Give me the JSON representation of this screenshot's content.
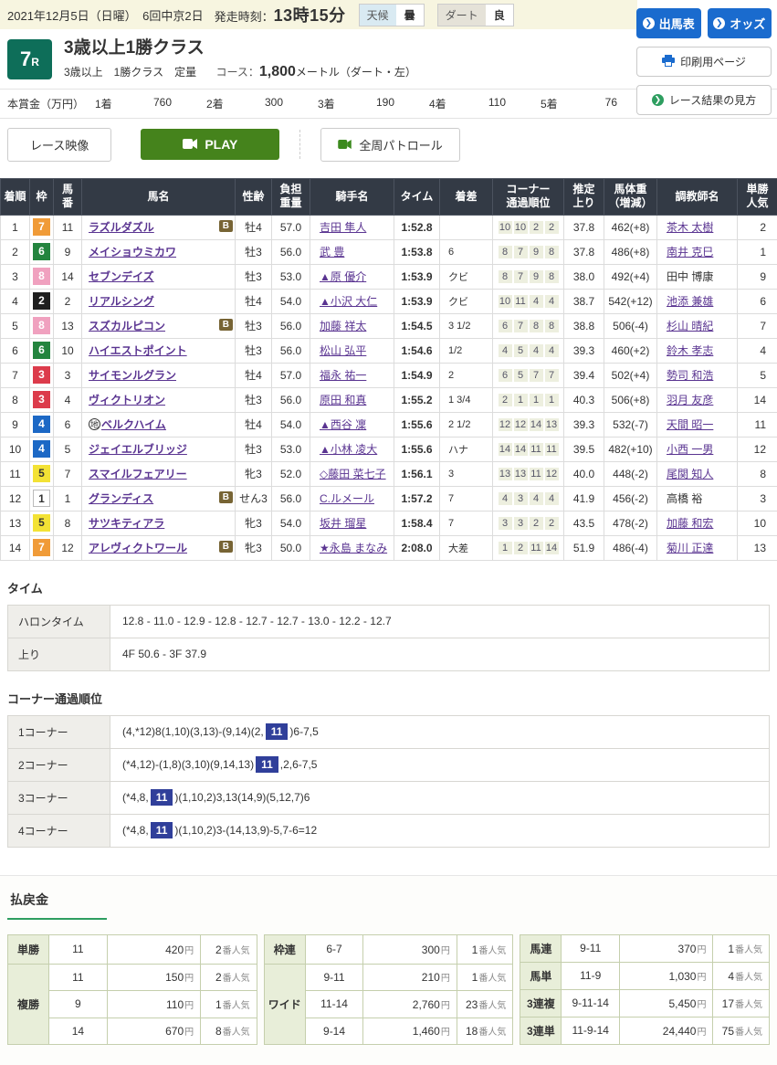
{
  "colors": {
    "accent_blue": "#1a6bce",
    "race_badge_teal": "#0e6e59",
    "link_purple": "#5a3491",
    "table_header": "#333a45",
    "play_green": "#45831c",
    "corner_highlight_navy": "#303f9a",
    "payout_underline_green": "#2e9e60"
  },
  "topbar": {
    "date_text": "2021年12月5日（日曜）　6回中京2日",
    "start_label": "発走時刻：",
    "start_time": "13時15分",
    "weather_label": "天候",
    "weather_value": "曇",
    "track_label": "ダート",
    "track_value": "良",
    "shutsuba_button": "出馬表",
    "odds_button": "オッズ"
  },
  "side_buttons": {
    "print_button": "印刷用ページ",
    "guide_button": "レース結果の見方"
  },
  "race": {
    "number": "7",
    "number_suffix": "R",
    "title": "3歳以上1勝クラス",
    "conditions": "3歳以上　1勝クラス　定量",
    "course_label": "コース：",
    "course_distance": "1,800",
    "course_detail": "メートル（ダート・左）",
    "prize_label": "本賞金（万円）",
    "prizes": [
      {
        "rank": "1着",
        "amount": "760"
      },
      {
        "rank": "2着",
        "amount": "300"
      },
      {
        "rank": "3着",
        "amount": "190"
      },
      {
        "rank": "4着",
        "amount": "110"
      },
      {
        "rank": "5着",
        "amount": "76"
      }
    ]
  },
  "video": {
    "race_video_button": "レース映像",
    "play_button": "PLAY",
    "patrol_button": "全周パトロール"
  },
  "results": {
    "b_label": "B",
    "local_mark": "地",
    "headers": [
      [
        "着順"
      ],
      [
        "枠"
      ],
      [
        "馬",
        "番"
      ],
      [
        "馬名"
      ],
      [
        "性齢"
      ],
      [
        "負担",
        "重量"
      ],
      [
        "騎手名"
      ],
      [
        "タイム"
      ],
      [
        "着差"
      ],
      [
        "コーナー",
        "通過順位"
      ],
      [
        "推定",
        "上り"
      ],
      [
        "馬体重",
        "（増減）"
      ],
      [
        "調教師名"
      ],
      [
        "単勝",
        "人気"
      ]
    ],
    "waku_colors": {
      "1": {
        "bg": "#ffffff",
        "fg": "#333333",
        "border": "#bbbbbb"
      },
      "2": {
        "bg": "#1f1f1f",
        "fg": "#ffffff"
      },
      "3": {
        "bg": "#dc3b4b",
        "fg": "#ffffff"
      },
      "4": {
        "bg": "#1c68c5",
        "fg": "#ffffff"
      },
      "5": {
        "bg": "#f3e235",
        "fg": "#333333"
      },
      "6": {
        "bg": "#23843e",
        "fg": "#ffffff"
      },
      "7": {
        "bg": "#f09b38",
        "fg": "#ffffff"
      },
      "8": {
        "bg": "#f0a1bf",
        "fg": "#ffffff"
      }
    },
    "rows": [
      {
        "pos": "1",
        "waku": "7",
        "num": "11",
        "horse": "ラズルダズル",
        "b": true,
        "local": false,
        "sex": "牡4",
        "weight": "57.0",
        "jockey": "吉田 隼人",
        "time": "1:52.8",
        "margin": "",
        "corners": [
          "10",
          "10",
          "2",
          "2"
        ],
        "last3f": "37.8",
        "hweight": "462(+8)",
        "trainer": "茶木 太樹",
        "trainer_link": true,
        "pop": "2"
      },
      {
        "pos": "2",
        "waku": "6",
        "num": "9",
        "horse": "メイショウミカワ",
        "b": false,
        "local": false,
        "sex": "牡3",
        "weight": "56.0",
        "jockey": "武 豊",
        "time": "1:53.8",
        "margin": "6",
        "corners": [
          "8",
          "7",
          "9",
          "8"
        ],
        "last3f": "37.8",
        "hweight": "486(+8)",
        "trainer": "南井 克巳",
        "trainer_link": true,
        "pop": "1"
      },
      {
        "pos": "3",
        "waku": "8",
        "num": "14",
        "horse": "セブンデイズ",
        "b": false,
        "local": false,
        "sex": "牡3",
        "weight": "53.0",
        "jockey": "▲原 優介",
        "time": "1:53.9",
        "margin": "クビ",
        "corners": [
          "8",
          "7",
          "9",
          "8"
        ],
        "last3f": "38.0",
        "hweight": "492(+4)",
        "trainer": "田中 博康",
        "trainer_link": false,
        "pop": "9"
      },
      {
        "pos": "4",
        "waku": "2",
        "num": "2",
        "horse": "リアルシング",
        "b": false,
        "local": false,
        "sex": "牡4",
        "weight": "54.0",
        "jockey": "▲小沢 大仁",
        "time": "1:53.9",
        "margin": "クビ",
        "corners": [
          "10",
          "11",
          "4",
          "4"
        ],
        "last3f": "38.7",
        "hweight": "542(+12)",
        "trainer": "池添 兼雄",
        "trainer_link": true,
        "pop": "6"
      },
      {
        "pos": "5",
        "waku": "8",
        "num": "13",
        "horse": "スズカルピコン",
        "b": true,
        "local": false,
        "sex": "牡3",
        "weight": "56.0",
        "jockey": "加藤 祥太",
        "time": "1:54.5",
        "margin": "3 1/2",
        "corners": [
          "6",
          "7",
          "8",
          "8"
        ],
        "last3f": "38.8",
        "hweight": "506(-4)",
        "trainer": "杉山 晴紀",
        "trainer_link": true,
        "pop": "7"
      },
      {
        "pos": "6",
        "waku": "6",
        "num": "10",
        "horse": "ハイエストポイント",
        "b": false,
        "local": false,
        "sex": "牡3",
        "weight": "56.0",
        "jockey": "松山 弘平",
        "time": "1:54.6",
        "margin": "1/2",
        "corners": [
          "4",
          "5",
          "4",
          "4"
        ],
        "last3f": "39.3",
        "hweight": "460(+2)",
        "trainer": "鈴木 孝志",
        "trainer_link": true,
        "pop": "4"
      },
      {
        "pos": "7",
        "waku": "3",
        "num": "3",
        "horse": "サイモンルグラン",
        "b": false,
        "local": false,
        "sex": "牡4",
        "weight": "57.0",
        "jockey": "福永 祐一",
        "time": "1:54.9",
        "margin": "2",
        "corners": [
          "6",
          "5",
          "7",
          "7"
        ],
        "last3f": "39.4",
        "hweight": "502(+4)",
        "trainer": "勢司 和浩",
        "trainer_link": true,
        "pop": "5"
      },
      {
        "pos": "8",
        "waku": "3",
        "num": "4",
        "horse": "ヴィクトリオン",
        "b": false,
        "local": false,
        "sex": "牡3",
        "weight": "56.0",
        "jockey": "原田 和真",
        "time": "1:55.2",
        "margin": "1 3/4",
        "corners": [
          "2",
          "1",
          "1",
          "1"
        ],
        "last3f": "40.3",
        "hweight": "506(+8)",
        "trainer": "羽月 友彦",
        "trainer_link": true,
        "pop": "14"
      },
      {
        "pos": "9",
        "waku": "4",
        "num": "6",
        "horse": "ベルクハイム",
        "b": false,
        "local": true,
        "sex": "牡4",
        "weight": "54.0",
        "jockey": "▲西谷 凜",
        "time": "1:55.6",
        "margin": "2 1/2",
        "corners": [
          "12",
          "12",
          "14",
          "13"
        ],
        "last3f": "39.3",
        "hweight": "532(-7)",
        "trainer": "天間 昭一",
        "trainer_link": true,
        "pop": "11"
      },
      {
        "pos": "10",
        "waku": "4",
        "num": "5",
        "horse": "ジェイエルブリッジ",
        "b": false,
        "local": false,
        "sex": "牡3",
        "weight": "53.0",
        "jockey": "▲小林 凌大",
        "time": "1:55.6",
        "margin": "ハナ",
        "corners": [
          "14",
          "14",
          "11",
          "11"
        ],
        "last3f": "39.5",
        "hweight": "482(+10)",
        "trainer": "小西 一男",
        "trainer_link": true,
        "pop": "12"
      },
      {
        "pos": "11",
        "waku": "5",
        "num": "7",
        "horse": "スマイルフェアリー",
        "b": false,
        "local": false,
        "sex": "牝3",
        "weight": "52.0",
        "jockey": "◇藤田 菜七子",
        "time": "1:56.1",
        "margin": "3",
        "corners": [
          "13",
          "13",
          "11",
          "12"
        ],
        "last3f": "40.0",
        "hweight": "448(-2)",
        "trainer": "尾関 知人",
        "trainer_link": true,
        "pop": "8"
      },
      {
        "pos": "12",
        "waku": "1",
        "num": "1",
        "horse": "グランディス",
        "b": true,
        "local": false,
        "sex": "せん3",
        "weight": "56.0",
        "jockey": "C.ルメール",
        "time": "1:57.2",
        "margin": "7",
        "corners": [
          "4",
          "3",
          "4",
          "4"
        ],
        "last3f": "41.9",
        "hweight": "456(-2)",
        "trainer": "高橋 裕",
        "trainer_link": false,
        "pop": "3"
      },
      {
        "pos": "13",
        "waku": "5",
        "num": "8",
        "horse": "サツキティアラ",
        "b": false,
        "local": false,
        "sex": "牝3",
        "weight": "54.0",
        "jockey": "坂井 瑠星",
        "time": "1:58.4",
        "margin": "7",
        "corners": [
          "3",
          "3",
          "2",
          "2"
        ],
        "last3f": "43.5",
        "hweight": "478(-2)",
        "trainer": "加藤 和宏",
        "trainer_link": true,
        "pop": "10"
      },
      {
        "pos": "14",
        "waku": "7",
        "num": "12",
        "horse": "アレヴィクトワール",
        "b": true,
        "local": false,
        "sex": "牝3",
        "weight": "50.0",
        "jockey": "★永島 まなみ",
        "time": "2:08.0",
        "margin": "大差",
        "corners": [
          "1",
          "2",
          "11",
          "14"
        ],
        "last3f": "51.9",
        "hweight": "486(-4)",
        "trainer": "菊川 正達",
        "trainer_link": true,
        "pop": "13"
      }
    ]
  },
  "time_section": {
    "title": "タイム",
    "rows": [
      {
        "label": "ハロンタイム",
        "value": "12.8 - 11.0 - 12.9 - 12.8 - 12.7 - 12.7 - 13.0 - 12.2 - 12.7"
      },
      {
        "label": "上り",
        "value": "4F 50.6 - 3F 37.9"
      }
    ]
  },
  "corner_section": {
    "title": "コーナー通過順位",
    "rows": [
      {
        "label": "1コーナー",
        "before": "(4,*12)8(1,10)(3,13)-(9,14)(2,",
        "mark": "11",
        "after": ")6-7,5"
      },
      {
        "label": "2コーナー",
        "before": "(*4,12)-(1,8)(3,10)(9,14,13)",
        "mark": "11",
        "after": ",2,6-7,5"
      },
      {
        "label": "3コーナー",
        "before": "(*4,8,",
        "mark": "11",
        "after": ")(1,10,2)3,13(14,9)(5,12,7)6"
      },
      {
        "label": "4コーナー",
        "before": "(*4,8,",
        "mark": "11",
        "after": ")(1,10,2)3-(14,13,9)-5,7-6=12"
      }
    ]
  },
  "payout": {
    "title": "払戻金",
    "unit_yen": "円",
    "unit_pop": "番人気",
    "tables": [
      [
        {
          "type": "単勝",
          "rows": [
            {
              "comb": "11",
              "amount": "420",
              "pop": "2"
            }
          ]
        },
        {
          "type": "複勝",
          "rows": [
            {
              "comb": "11",
              "amount": "150",
              "pop": "2"
            },
            {
              "comb": "9",
              "amount": "110",
              "pop": "1"
            },
            {
              "comb": "14",
              "amount": "670",
              "pop": "8"
            }
          ]
        }
      ],
      [
        {
          "type": "枠連",
          "rows": [
            {
              "comb": "6-7",
              "amount": "300",
              "pop": "1"
            }
          ]
        },
        {
          "type": "ワイド",
          "rows": [
            {
              "comb": "9-11",
              "amount": "210",
              "pop": "1"
            },
            {
              "comb": "11-14",
              "amount": "2,760",
              "pop": "23"
            },
            {
              "comb": "9-14",
              "amount": "1,460",
              "pop": "18"
            }
          ]
        }
      ],
      [
        {
          "type": "馬連",
          "rows": [
            {
              "comb": "9-11",
              "amount": "370",
              "pop": "1"
            }
          ]
        },
        {
          "type": "馬単",
          "rows": [
            {
              "comb": "11-9",
              "amount": "1,030",
              "pop": "4"
            }
          ]
        },
        {
          "type": "3連複",
          "rows": [
            {
              "comb": "9-11-14",
              "amount": "5,450",
              "pop": "17"
            }
          ]
        },
        {
          "type": "3連単",
          "rows": [
            {
              "comb": "11-9-14",
              "amount": "24,440",
              "pop": "75"
            }
          ]
        }
      ]
    ]
  }
}
